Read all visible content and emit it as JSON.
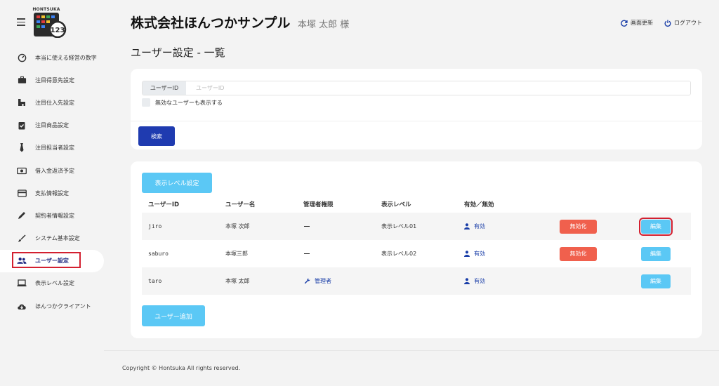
{
  "logo": {
    "text": "HONTSUKA"
  },
  "sidebar": {
    "items": [
      {
        "label": "本当に使える経営の数字",
        "icon": "gauge-icon"
      },
      {
        "label": "注目得意先設定",
        "icon": "briefcase-icon"
      },
      {
        "label": "注目仕入先設定",
        "icon": "building-icon"
      },
      {
        "label": "注目商品設定",
        "icon": "clipboard-check-icon"
      },
      {
        "label": "注目担当者設定",
        "icon": "tie-icon"
      },
      {
        "label": "借入金返済予定",
        "icon": "money-icon"
      },
      {
        "label": "支払情報設定",
        "icon": "credit-card-icon"
      },
      {
        "label": "契約者情報設定",
        "icon": "pen-icon"
      },
      {
        "label": "システム基本設定",
        "icon": "brush-icon"
      },
      {
        "label": "ユーザー設定",
        "icon": "users-icon"
      },
      {
        "label": "表示レベル設定",
        "icon": "laptop-icon"
      },
      {
        "label": "ほんつかクライアント",
        "icon": "cloud-download-icon"
      }
    ]
  },
  "header": {
    "company": "株式会社ほんつかサンプル",
    "user": "本塚 太郎 様",
    "refresh_label": "画面更新",
    "logout_label": "ログアウト"
  },
  "page": {
    "title": "ユーザー設定 - 一覧"
  },
  "search": {
    "user_id_label": "ユーザーID",
    "user_id_placeholder": "ユーザーID",
    "user_id_value": "",
    "show_inactive_label": "無効なユーザーも表示する",
    "search_button": "検索"
  },
  "table": {
    "level_button": "表示レベル設定",
    "columns": [
      "ユーザーID",
      "ユーザー名",
      "管理者権限",
      "表示レベル",
      "有効／無効"
    ],
    "rows": [
      {
        "id": "jiro",
        "name": "本塚 次郎",
        "admin": "",
        "level": "表示レベル01",
        "status": "有効",
        "disable": "無効化",
        "edit": "編集"
      },
      {
        "id": "saburo",
        "name": "本塚三郎",
        "admin": "",
        "level": "表示レベル02",
        "status": "有効",
        "disable": "無効化",
        "edit": "編集"
      },
      {
        "id": "taro",
        "name": "本塚 太郎",
        "admin": "管理者",
        "level": "",
        "status": "有効",
        "disable": "",
        "edit": "編集"
      }
    ],
    "add_button": "ユーザー追加"
  },
  "footer": {
    "copyright": "Copyright © Hontsuka All rights reserved."
  },
  "colors": {
    "primary": "#1f3bb0",
    "accent": "#5bc8f5",
    "danger": "#f0604d",
    "highlight": "#d32030"
  }
}
